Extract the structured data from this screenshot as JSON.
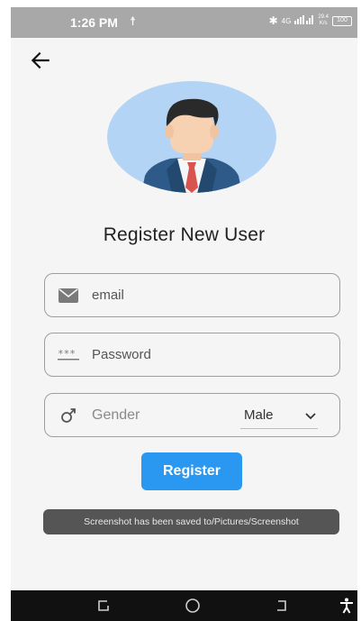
{
  "status_bar": {
    "time": "1:26 PM",
    "network": "4G",
    "speed_value": "29.4",
    "speed_unit": "K/s",
    "battery": "100"
  },
  "page": {
    "title": "Register New User"
  },
  "form": {
    "email_placeholder": "email",
    "password_placeholder": "Password",
    "gender_label": "Gender",
    "gender_value": "Male",
    "register_label": "Register"
  },
  "toast": {
    "message": "Screenshot has been saved to/Pictures/Screenshot"
  },
  "colors": {
    "primary": "#2a98f0",
    "avatar_bg": "#b3d4f5",
    "suit": "#2e5a8a",
    "tie": "#d9534f",
    "toast_bg": "#555555"
  },
  "icons": {
    "back": "arrow-left-icon",
    "email": "envelope-icon",
    "password": "asterisk-password-icon",
    "gender": "male-symbol-icon",
    "dropdown": "chevron-down-icon"
  }
}
